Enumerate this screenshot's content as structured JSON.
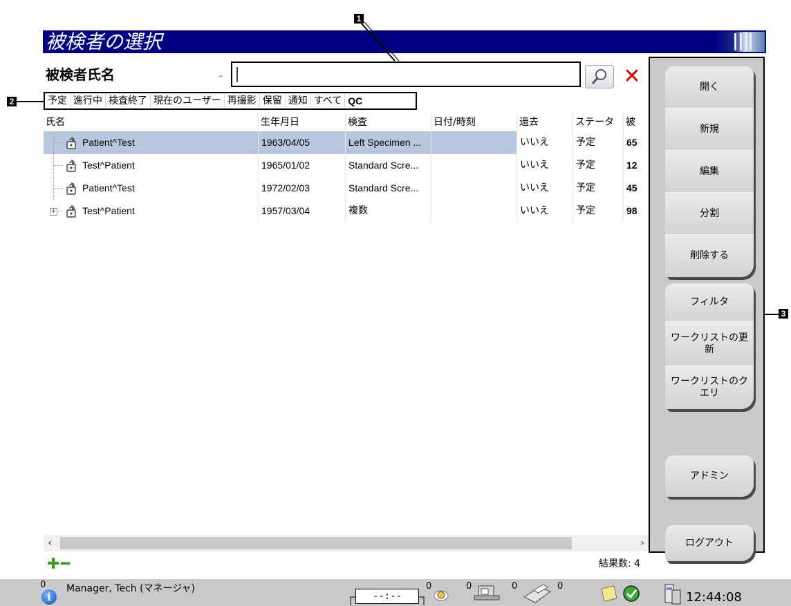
{
  "window": {
    "title": "被検者の選択"
  },
  "search": {
    "field_select": "被検者氏名",
    "value": ""
  },
  "filter_tabs": [
    "予定",
    "進行中",
    "検査終了",
    "現在のユーザー",
    "再撮影",
    "保留",
    "通知",
    "すべて",
    "QC"
  ],
  "table": {
    "columns": [
      "氏名",
      "生年月日",
      "検査",
      "日付/時刻",
      "過去",
      "ステータス",
      "被"
    ],
    "rows": [
      {
        "name": "Patient^Test",
        "dob": "1963/04/05",
        "exam": "Left Specimen ...",
        "datetime": "",
        "prior": "いいえ",
        "status": "予定",
        "id": "65"
      },
      {
        "name": "Test^Patient",
        "dob": "1965/01/02",
        "exam": "Standard Scre...",
        "datetime": "",
        "prior": "いいえ",
        "status": "予定",
        "id": "12"
      },
      {
        "name": "Patient^Test",
        "dob": "1972/02/03",
        "exam": "Standard Scre...",
        "datetime": "",
        "prior": "いいえ",
        "status": "予定",
        "id": "45"
      },
      {
        "name": "Test^Patient",
        "dob": "1957/03/04",
        "exam": "複数",
        "datetime": "",
        "prior": "いいえ",
        "status": "予定",
        "id": "98"
      }
    ]
  },
  "results_count": "結果数: 4",
  "side_panel": {
    "group1": [
      "開く",
      "新規",
      "編集",
      "分割",
      "削除する"
    ],
    "group2": [
      "フィルタ",
      "ワークリストの更新",
      "ワークリストのクエリ"
    ],
    "admin": "アドミン",
    "logout": "ログアウト"
  },
  "callouts": [
    "1",
    "2",
    "3"
  ],
  "status_bar": {
    "alarm_count": "0",
    "user": "Manager, Tech (マネージャ)",
    "timer": "--:--",
    "counts": [
      "0",
      "0",
      "0",
      "0"
    ],
    "time": "12:44:08"
  },
  "colors": {
    "title_bar": "#000080",
    "selected_row": "#b7c8de",
    "panel": "#c9c9c9",
    "clear_red": "#d00000",
    "add_green": "#3a9a21"
  }
}
